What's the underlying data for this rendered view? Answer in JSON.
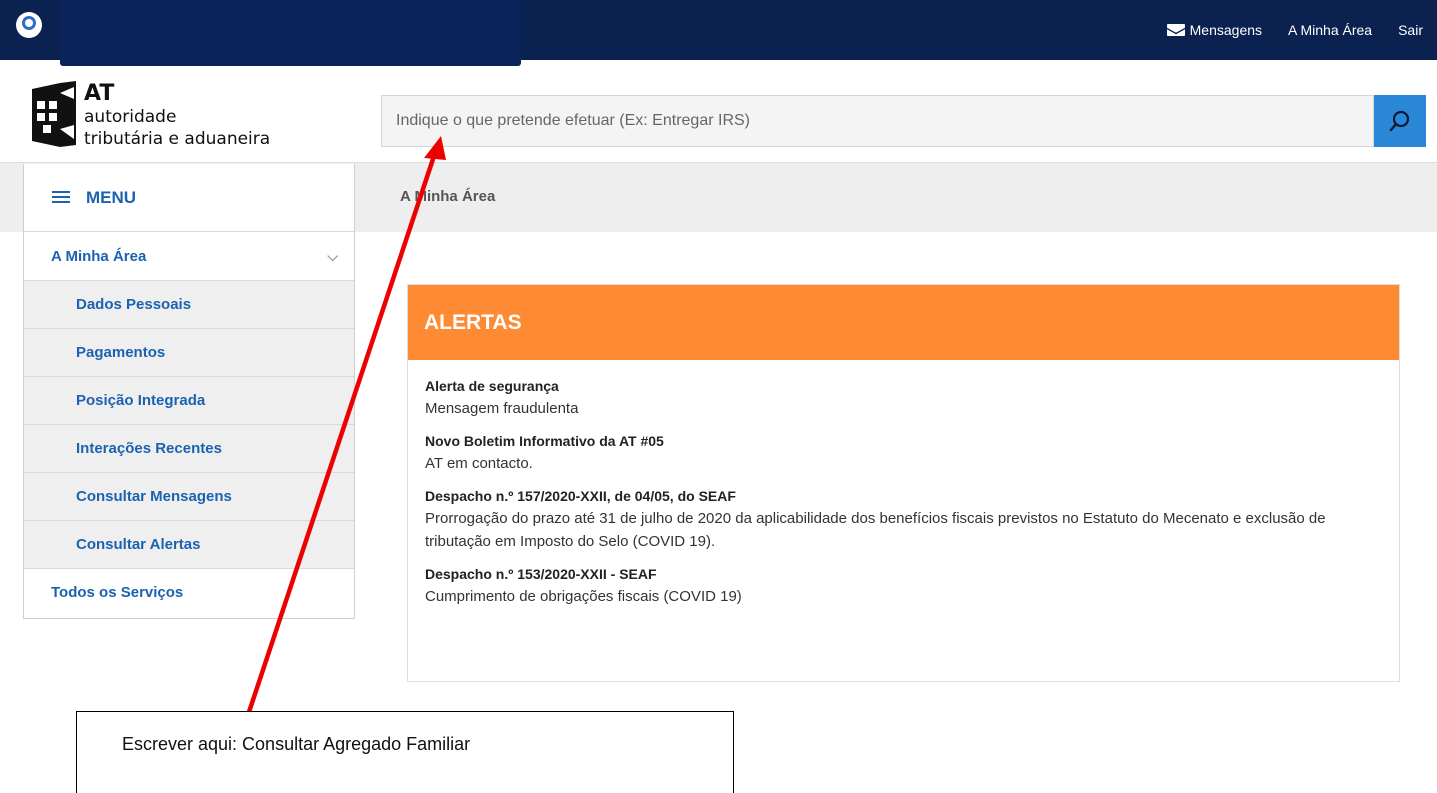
{
  "topbar": {
    "nav": {
      "messages": "Mensagens",
      "my_area": "A Minha Área",
      "logout": "Sair"
    }
  },
  "brand": {
    "line1": "AT",
    "line2": "autoridade",
    "line3": "tributária e aduaneira"
  },
  "search": {
    "placeholder": "Indique o que pretende efetuar (Ex: Entregar IRS)",
    "value": "",
    "button_icon": "search-icon"
  },
  "breadcrumb": {
    "current": "A Minha Área"
  },
  "sidebar": {
    "menu_label": "MENU",
    "parent": "A Minha Área",
    "children": [
      "Dados Pessoais",
      "Pagamentos",
      "Posição Integrada",
      "Interações Recentes",
      "Consultar Mensagens",
      "Consultar Alertas"
    ],
    "all_services": "Todos os Serviços"
  },
  "alerts": {
    "header": "ALERTAS",
    "items": [
      {
        "title": "Alerta de segurança",
        "body": "Mensagem fraudulenta"
      },
      {
        "title": "Novo Boletim Informativo da AT #05",
        "body": "AT em contacto."
      },
      {
        "title": "Despacho n.º 157/2020-XXII, de 04/05, do SEAF",
        "body": "Prorrogação do prazo até 31 de julho de 2020 da aplicabilidade dos benefícios fiscais previstos no Estatuto do Mecenato e exclusão de tributação em Imposto do Selo (COVID 19)."
      },
      {
        "title": "Despacho n.º 153/2020-XXII - SEAF",
        "body": "Cumprimento de obrigações fiscais (COVID 19)"
      }
    ]
  },
  "annotation": {
    "text": "Escrever aqui: Consultar Agregado Familiar",
    "arrow_color": "#ee0000"
  },
  "colors": {
    "topbar": "#0b2150",
    "accent": "#2a87d8",
    "link": "#1b62b0",
    "alerts_header": "#ff8a34"
  }
}
